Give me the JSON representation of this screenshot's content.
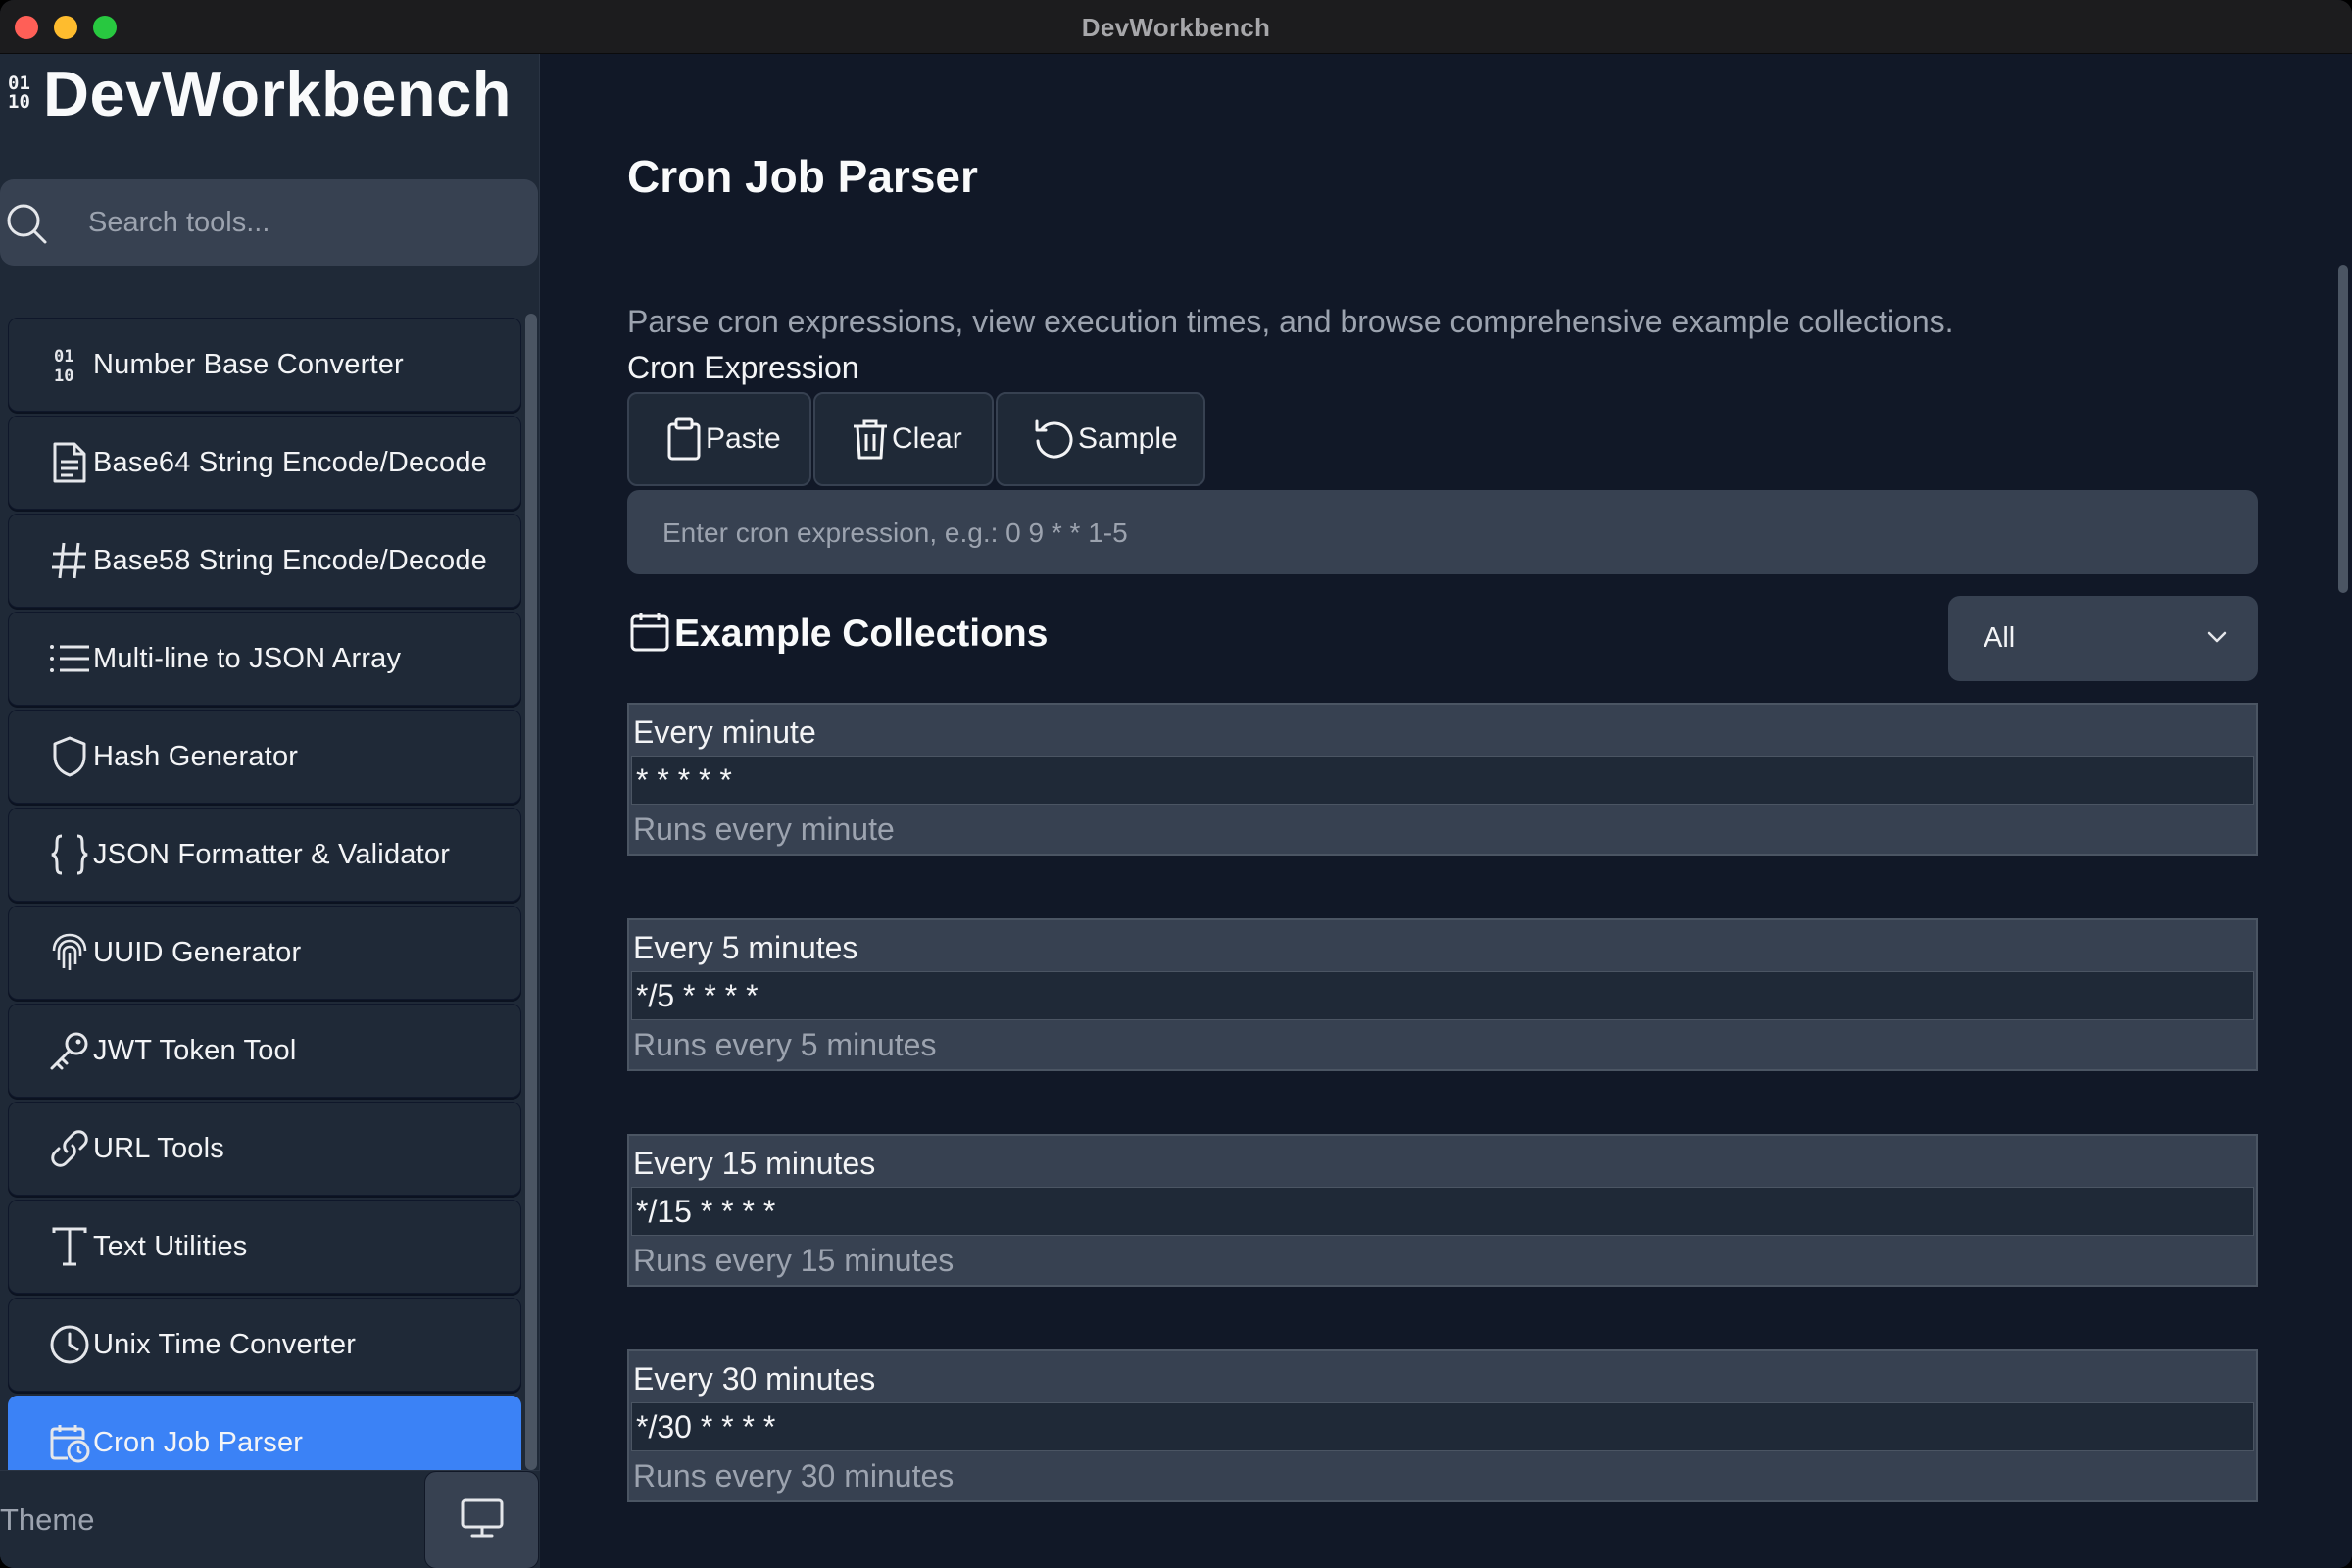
{
  "window": {
    "title": "DevWorkbench"
  },
  "brand": {
    "logo": "01 10",
    "name": "DevWorkbench"
  },
  "search": {
    "placeholder": "Search tools..."
  },
  "nav": [
    {
      "label": "Number Base Converter",
      "icon": "binary-icon"
    },
    {
      "label": "Base64 String Encode/Decode",
      "icon": "document-icon"
    },
    {
      "label": "Base58 String Encode/Decode",
      "icon": "hash-icon"
    },
    {
      "label": "Multi-line to JSON Array",
      "icon": "list-icon"
    },
    {
      "label": "Hash Generator",
      "icon": "shield-icon"
    },
    {
      "label": "JSON Formatter & Validator",
      "icon": "braces-icon"
    },
    {
      "label": "UUID Generator",
      "icon": "fingerprint-icon"
    },
    {
      "label": "JWT Token Tool",
      "icon": "key-icon"
    },
    {
      "label": "URL Tools",
      "icon": "link-icon"
    },
    {
      "label": "Text Utilities",
      "icon": "text-icon"
    },
    {
      "label": "Unix Time Converter",
      "icon": "clock-icon"
    },
    {
      "label": "Cron Job Parser",
      "icon": "calendar-clock-icon",
      "active": true
    }
  ],
  "theme": {
    "label": "Theme",
    "icon": "monitor-icon"
  },
  "main": {
    "title": "Cron Job Parser",
    "description": "Parse cron expressions, view execution times, and browse comprehensive example collections.",
    "field_label": "Cron Expression",
    "buttons": {
      "paste": "Paste",
      "clear": "Clear",
      "sample": "Sample"
    },
    "input_placeholder": "Enter cron expression, e.g.: 0 9 * * 1-5",
    "examples_title": "Example Collections",
    "filter_value": "All",
    "examples": [
      {
        "name": "Every minute",
        "expr": "* * * * *",
        "desc": "Runs every minute"
      },
      {
        "name": "Every 5 minutes",
        "expr": "*/5 * * * *",
        "desc": "Runs every 5 minutes"
      },
      {
        "name": "Every 15 minutes",
        "expr": "*/15 * * * *",
        "desc": "Runs every 15 minutes"
      },
      {
        "name": "Every 30 minutes",
        "expr": "*/30 * * * *",
        "desc": "Runs every 30 minutes"
      }
    ]
  },
  "colors": {
    "accent": "#3b82f6",
    "sidebar": "#1f2937",
    "background": "#111827"
  }
}
